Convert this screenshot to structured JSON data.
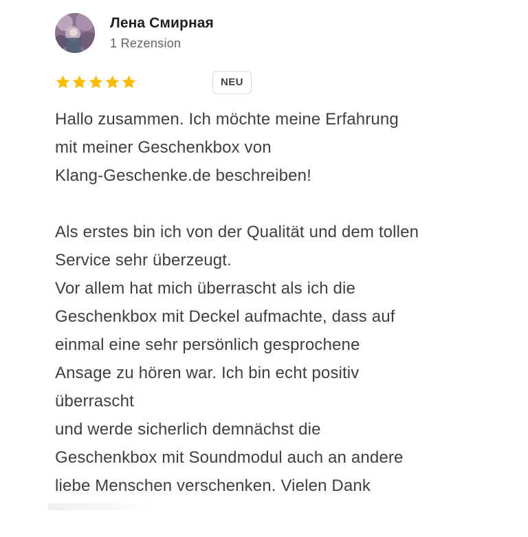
{
  "review": {
    "author": {
      "name": "Лена Смирная",
      "meta": "1 Rezension",
      "avatar_icon": "user-avatar-photo"
    },
    "rating": {
      "stars": 5,
      "max_stars": 5,
      "star_color": "#fbbc04",
      "star_icon": "star-icon"
    },
    "badge": "NEU",
    "text_lines": [
      "Hallo zusammen. Ich möchte meine Erfahrung",
      "mit meiner Geschenkbox von",
      "Klang-Geschenke.de beschreiben!",
      "",
      "Als erstes bin ich von der Qualität und dem tollen",
      "Service sehr überzeugt.",
      "Vor allem hat mich überrascht als ich die",
      "Geschenkbox mit Deckel aufmachte, dass auf",
      "einmal eine sehr persönlich gesprochene",
      "Ansage zu hören war. Ich bin echt positiv",
      "überrascht",
      "und werde sicherlich demnächst die",
      "Geschenkbox mit Soundmodul auch an andere",
      "liebe Menschen verschenken. Vielen Dank"
    ]
  }
}
